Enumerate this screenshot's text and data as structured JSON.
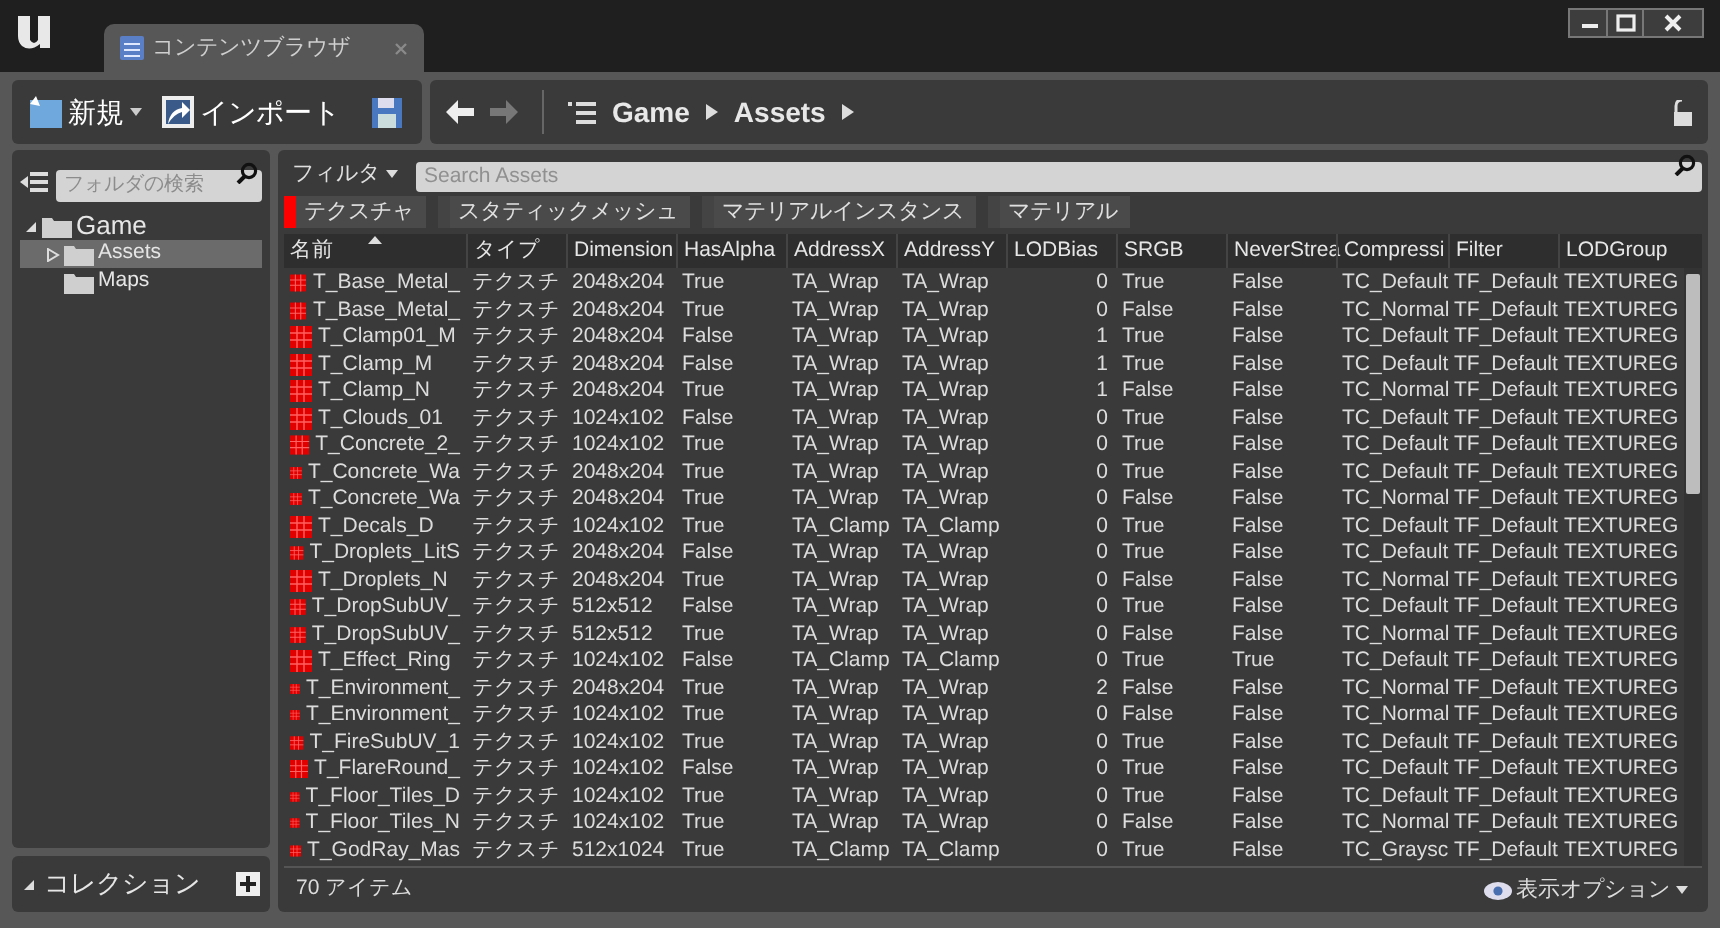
{
  "window": {
    "tab_title": "コンテンツブラウザ"
  },
  "toolbar": {
    "new_button": "新規",
    "import_button": "インポート",
    "path": [
      "Game",
      "Assets"
    ]
  },
  "sidebar": {
    "search": {
      "placeholder": "フォルダの検索"
    },
    "tree": [
      {
        "label": "Game",
        "expanded": true,
        "selected": false,
        "children": [
          {
            "label": "Assets",
            "expanded": false,
            "selected": true
          },
          {
            "label": "Maps",
            "selected": false
          }
        ]
      }
    ],
    "collections": {
      "label": "コレクション",
      "expanded": true
    }
  },
  "filter_bar": {
    "filter_button": "フィルタ",
    "search": {
      "placeholder": "Search Assets"
    }
  },
  "filters": [
    {
      "label": "テクスチャ",
      "selected": true
    },
    {
      "label": "スタティックメッシュ",
      "selected": false
    },
    {
      "label": "マテリアルインスタンス",
      "selected": false
    },
    {
      "label": "マテリアル",
      "selected": false
    }
  ],
  "table": {
    "columns": [
      {
        "label": "名前",
        "sorted": true
      },
      {
        "label": "タイプ",
        "sorted": false
      },
      {
        "label": "Dimension",
        "sorted": false
      },
      {
        "label": "HasAlpha",
        "sorted": false
      },
      {
        "label": "AddressX",
        "sorted": false
      },
      {
        "label": "AddressY",
        "sorted": false
      },
      {
        "label": "LODBias",
        "sorted": false
      },
      {
        "label": "SRGB",
        "sorted": false
      },
      {
        "label": "NeverStrea",
        "sorted": false
      },
      {
        "label": "Compressi",
        "sorted": false
      },
      {
        "label": "Filter",
        "sorted": false
      },
      {
        "label": "LODGroup",
        "sorted": false
      }
    ],
    "rows": [
      [
        "T_Base_Metal_",
        "テクスチ",
        "2048x204",
        "True",
        "TA_Wrap",
        "TA_Wrap",
        "0",
        "True",
        "False",
        "TC_Default",
        "TF_Default",
        "TEXTUREG"
      ],
      [
        "T_Base_Metal_",
        "テクスチ",
        "2048x204",
        "True",
        "TA_Wrap",
        "TA_Wrap",
        "0",
        "False",
        "False",
        "TC_Normal",
        "TF_Default",
        "TEXTUREG"
      ],
      [
        "T_Clamp01_M",
        "テクスチ",
        "2048x204",
        "False",
        "TA_Wrap",
        "TA_Wrap",
        "1",
        "True",
        "False",
        "TC_Default",
        "TF_Default",
        "TEXTUREG"
      ],
      [
        "T_Clamp_M",
        "テクスチ",
        "2048x204",
        "False",
        "TA_Wrap",
        "TA_Wrap",
        "1",
        "True",
        "False",
        "TC_Default",
        "TF_Default",
        "TEXTUREG"
      ],
      [
        "T_Clamp_N",
        "テクスチ",
        "2048x204",
        "True",
        "TA_Wrap",
        "TA_Wrap",
        "1",
        "False",
        "False",
        "TC_Normal",
        "TF_Default",
        "TEXTUREG"
      ],
      [
        "T_Clouds_01",
        "テクスチ",
        "1024x102",
        "False",
        "TA_Wrap",
        "TA_Wrap",
        "0",
        "True",
        "False",
        "TC_Default",
        "TF_Default",
        "TEXTUREG"
      ],
      [
        "T_Concrete_2_",
        "テクスチ",
        "1024x102",
        "True",
        "TA_Wrap",
        "TA_Wrap",
        "0",
        "True",
        "False",
        "TC_Default",
        "TF_Default",
        "TEXTUREG"
      ],
      [
        "T_Concrete_Wa",
        "テクスチ",
        "2048x204",
        "True",
        "TA_Wrap",
        "TA_Wrap",
        "0",
        "True",
        "False",
        "TC_Default",
        "TF_Default",
        "TEXTUREG"
      ],
      [
        "T_Concrete_Wa",
        "テクスチ",
        "2048x204",
        "True",
        "TA_Wrap",
        "TA_Wrap",
        "0",
        "False",
        "False",
        "TC_Normal",
        "TF_Default",
        "TEXTUREG"
      ],
      [
        "T_Decals_D",
        "テクスチ",
        "1024x102",
        "True",
        "TA_Clamp",
        "TA_Clamp",
        "0",
        "True",
        "False",
        "TC_Default",
        "TF_Default",
        "TEXTUREG"
      ],
      [
        "T_Droplets_LitS",
        "テクスチ",
        "2048x204",
        "False",
        "TA_Wrap",
        "TA_Wrap",
        "0",
        "True",
        "False",
        "TC_Default",
        "TF_Default",
        "TEXTUREG"
      ],
      [
        "T_Droplets_N",
        "テクスチ",
        "2048x204",
        "True",
        "TA_Wrap",
        "TA_Wrap",
        "0",
        "False",
        "False",
        "TC_Normal",
        "TF_Default",
        "TEXTUREG"
      ],
      [
        "T_DropSubUV_",
        "テクスチ",
        "512x512",
        "False",
        "TA_Wrap",
        "TA_Wrap",
        "0",
        "True",
        "False",
        "TC_Default",
        "TF_Default",
        "TEXTUREG"
      ],
      [
        "T_DropSubUV_",
        "テクスチ",
        "512x512",
        "True",
        "TA_Wrap",
        "TA_Wrap",
        "0",
        "False",
        "False",
        "TC_Normal",
        "TF_Default",
        "TEXTUREG"
      ],
      [
        "T_Effect_Ring",
        "テクスチ",
        "1024x102",
        "False",
        "TA_Clamp",
        "TA_Clamp",
        "0",
        "True",
        "True",
        "TC_Default",
        "TF_Default",
        "TEXTUREG"
      ],
      [
        "T_Environment_",
        "テクスチ",
        "2048x204",
        "True",
        "TA_Wrap",
        "TA_Wrap",
        "2",
        "False",
        "False",
        "TC_Normal",
        "TF_Default",
        "TEXTUREG"
      ],
      [
        "T_Environment_",
        "テクスチ",
        "1024x102",
        "True",
        "TA_Wrap",
        "TA_Wrap",
        "0",
        "False",
        "False",
        "TC_Normal",
        "TF_Default",
        "TEXTUREG"
      ],
      [
        "T_FireSubUV_1",
        "テクスチ",
        "1024x102",
        "True",
        "TA_Wrap",
        "TA_Wrap",
        "0",
        "True",
        "False",
        "TC_Default",
        "TF_Default",
        "TEXTUREG"
      ],
      [
        "T_FlareRound_",
        "テクスチ",
        "1024x102",
        "False",
        "TA_Wrap",
        "TA_Wrap",
        "0",
        "True",
        "False",
        "TC_Default",
        "TF_Default",
        "TEXTUREG"
      ],
      [
        "T_Floor_Tiles_D",
        "テクスチ",
        "1024x102",
        "True",
        "TA_Wrap",
        "TA_Wrap",
        "0",
        "True",
        "False",
        "TC_Default",
        "TF_Default",
        "TEXTUREG"
      ],
      [
        "T_Floor_Tiles_N",
        "テクスチ",
        "1024x102",
        "True",
        "TA_Wrap",
        "TA_Wrap",
        "0",
        "False",
        "False",
        "TC_Normal",
        "TF_Default",
        "TEXTUREG"
      ],
      [
        "T_GodRay_Mas",
        "テクスチ",
        "512x1024",
        "True",
        "TA_Clamp",
        "TA_Clamp",
        "0",
        "True",
        "False",
        "TC_Graysc",
        "TF_Default",
        "TEXTUREG"
      ]
    ]
  },
  "status_bar": {
    "item_count": "70 アイテム",
    "view_options": "表示オプション"
  }
}
